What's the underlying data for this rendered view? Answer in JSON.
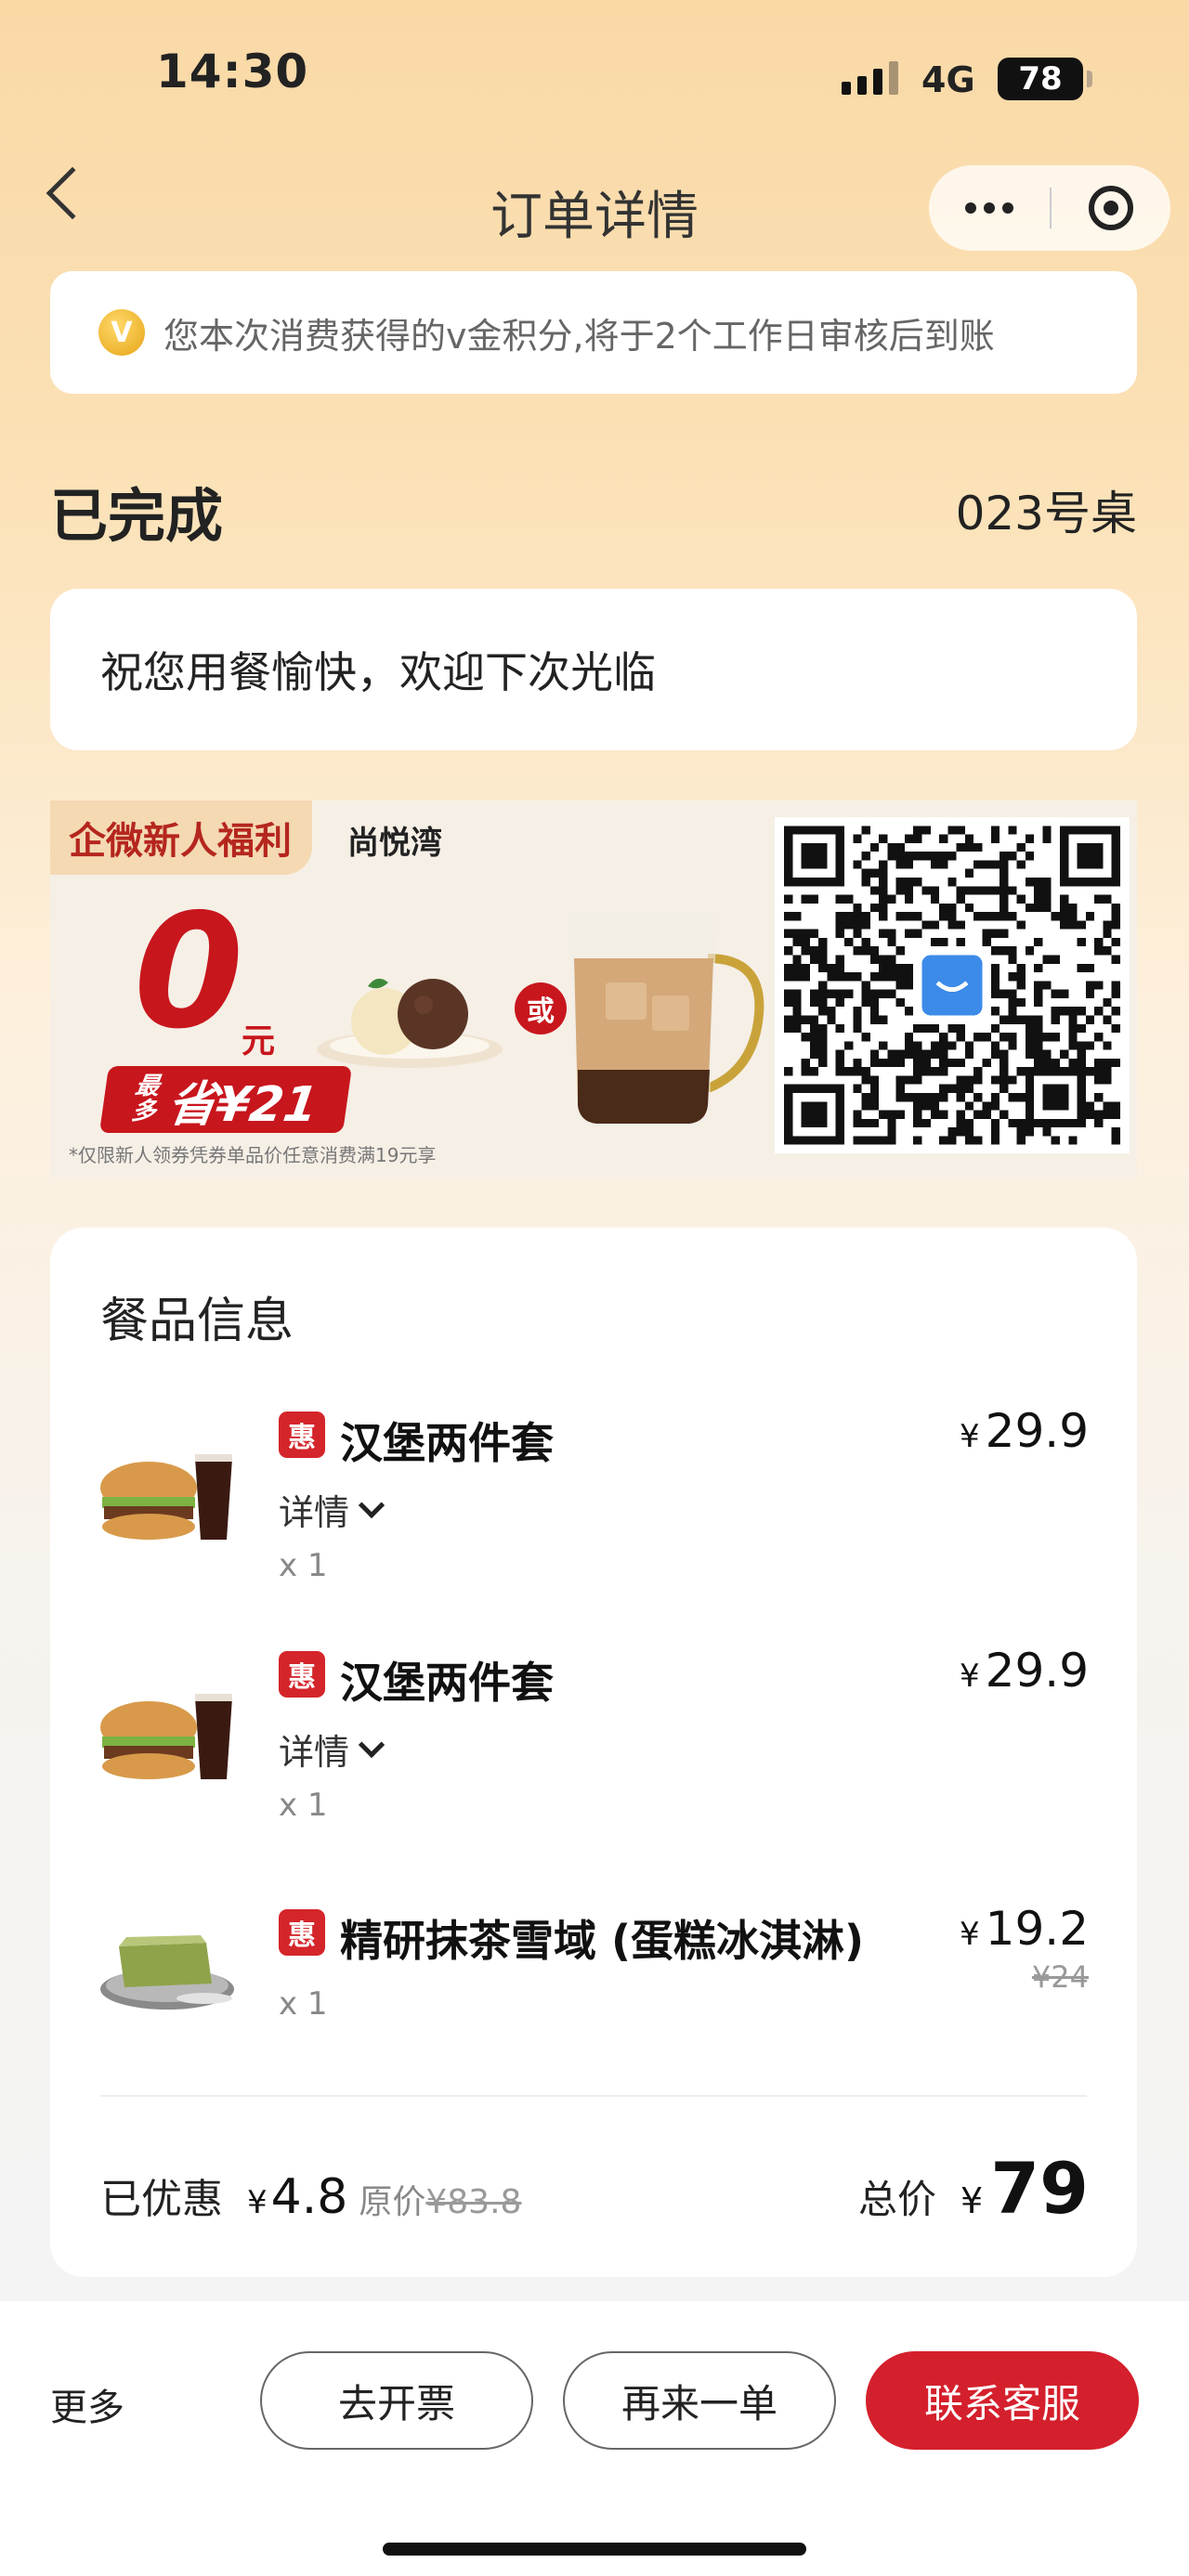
{
  "status_bar": {
    "time": "14:30",
    "network": "4G",
    "battery": "78"
  },
  "nav": {
    "title": "订单详情"
  },
  "notice": {
    "icon": "V",
    "text": "您本次消费获得的v金积分,将于2个工作日审核后到账"
  },
  "order": {
    "status": "已完成",
    "table": "023号桌",
    "greeting": "祝您用餐愉快，欢迎下次光临"
  },
  "promo": {
    "tag": "企微新人福利",
    "store": "尚悦湾",
    "zero": "0",
    "yuan": "元",
    "save_small": "最多",
    "save_text": "省¥21",
    "or": "或",
    "disclaimer": "*仅限新人领券凭券单品价任意消费满19元享"
  },
  "food": {
    "title": "餐品信息",
    "badge": "惠",
    "detail_label": "详情",
    "currency": "¥",
    "items": [
      {
        "name": "汉堡两件套",
        "price": "29.9",
        "qty": "x 1"
      },
      {
        "name": "汉堡两件套",
        "price": "29.9",
        "qty": "x 1"
      },
      {
        "name": "精研抹茶雪域 (蛋糕冰淇淋)",
        "price": "19.2",
        "original": "¥24",
        "qty": "x 1"
      }
    ],
    "discount_label": "已优惠",
    "discount_amount": "4.8",
    "original_label": "原价",
    "original_total": "¥83.8",
    "total_label": "总价",
    "total": "79"
  },
  "bottom": {
    "more": "更多",
    "invoice": "去开票",
    "reorder": "再来一单",
    "service": "联系客服"
  },
  "colors": {
    "accent": "#d4202c",
    "background_top": "#f9d9a6"
  }
}
